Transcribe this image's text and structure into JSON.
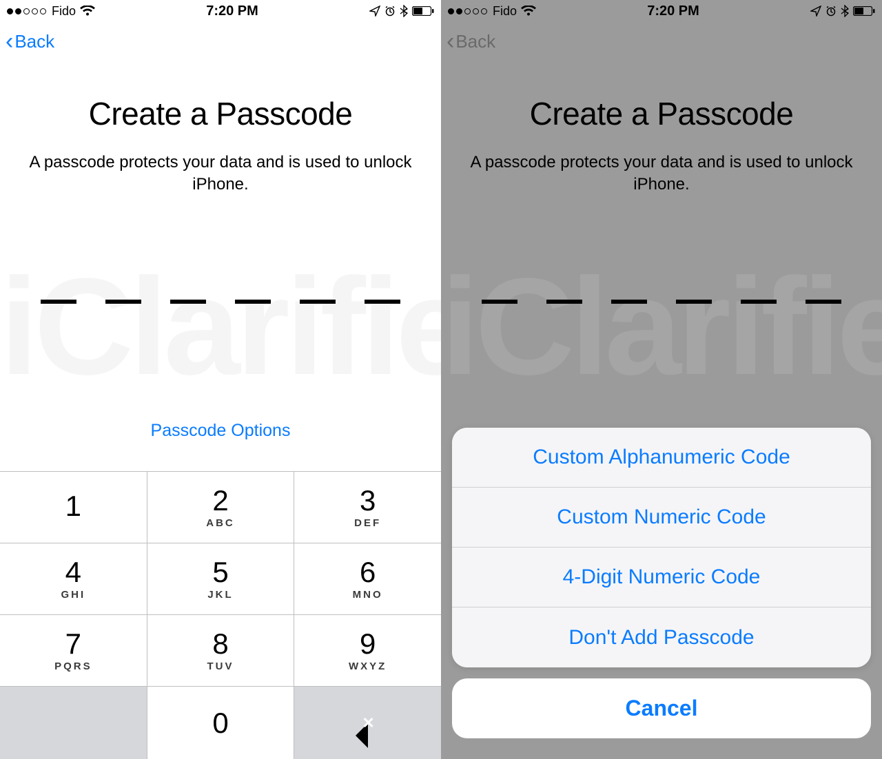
{
  "status": {
    "carrier": "Fido",
    "time": "7:20 PM"
  },
  "nav": {
    "back": "Back"
  },
  "page": {
    "title": "Create a Passcode",
    "subtitle": "A passcode protects your data and is used to unlock iPhone.",
    "options_link": "Passcode Options"
  },
  "keypad": {
    "k1": {
      "num": "1",
      "let": ""
    },
    "k2": {
      "num": "2",
      "let": "ABC"
    },
    "k3": {
      "num": "3",
      "let": "DEF"
    },
    "k4": {
      "num": "4",
      "let": "GHI"
    },
    "k5": {
      "num": "5",
      "let": "JKL"
    },
    "k6": {
      "num": "6",
      "let": "MNO"
    },
    "k7": {
      "num": "7",
      "let": "PQRS"
    },
    "k8": {
      "num": "8",
      "let": "TUV"
    },
    "k9": {
      "num": "9",
      "let": "WXYZ"
    },
    "k0": {
      "num": "0",
      "let": ""
    }
  },
  "sheet": {
    "opt1": "Custom Alphanumeric Code",
    "opt2": "Custom Numeric Code",
    "opt3": "4-Digit Numeric Code",
    "opt4": "Don't Add Passcode",
    "cancel": "Cancel"
  },
  "watermark": "iClarified"
}
